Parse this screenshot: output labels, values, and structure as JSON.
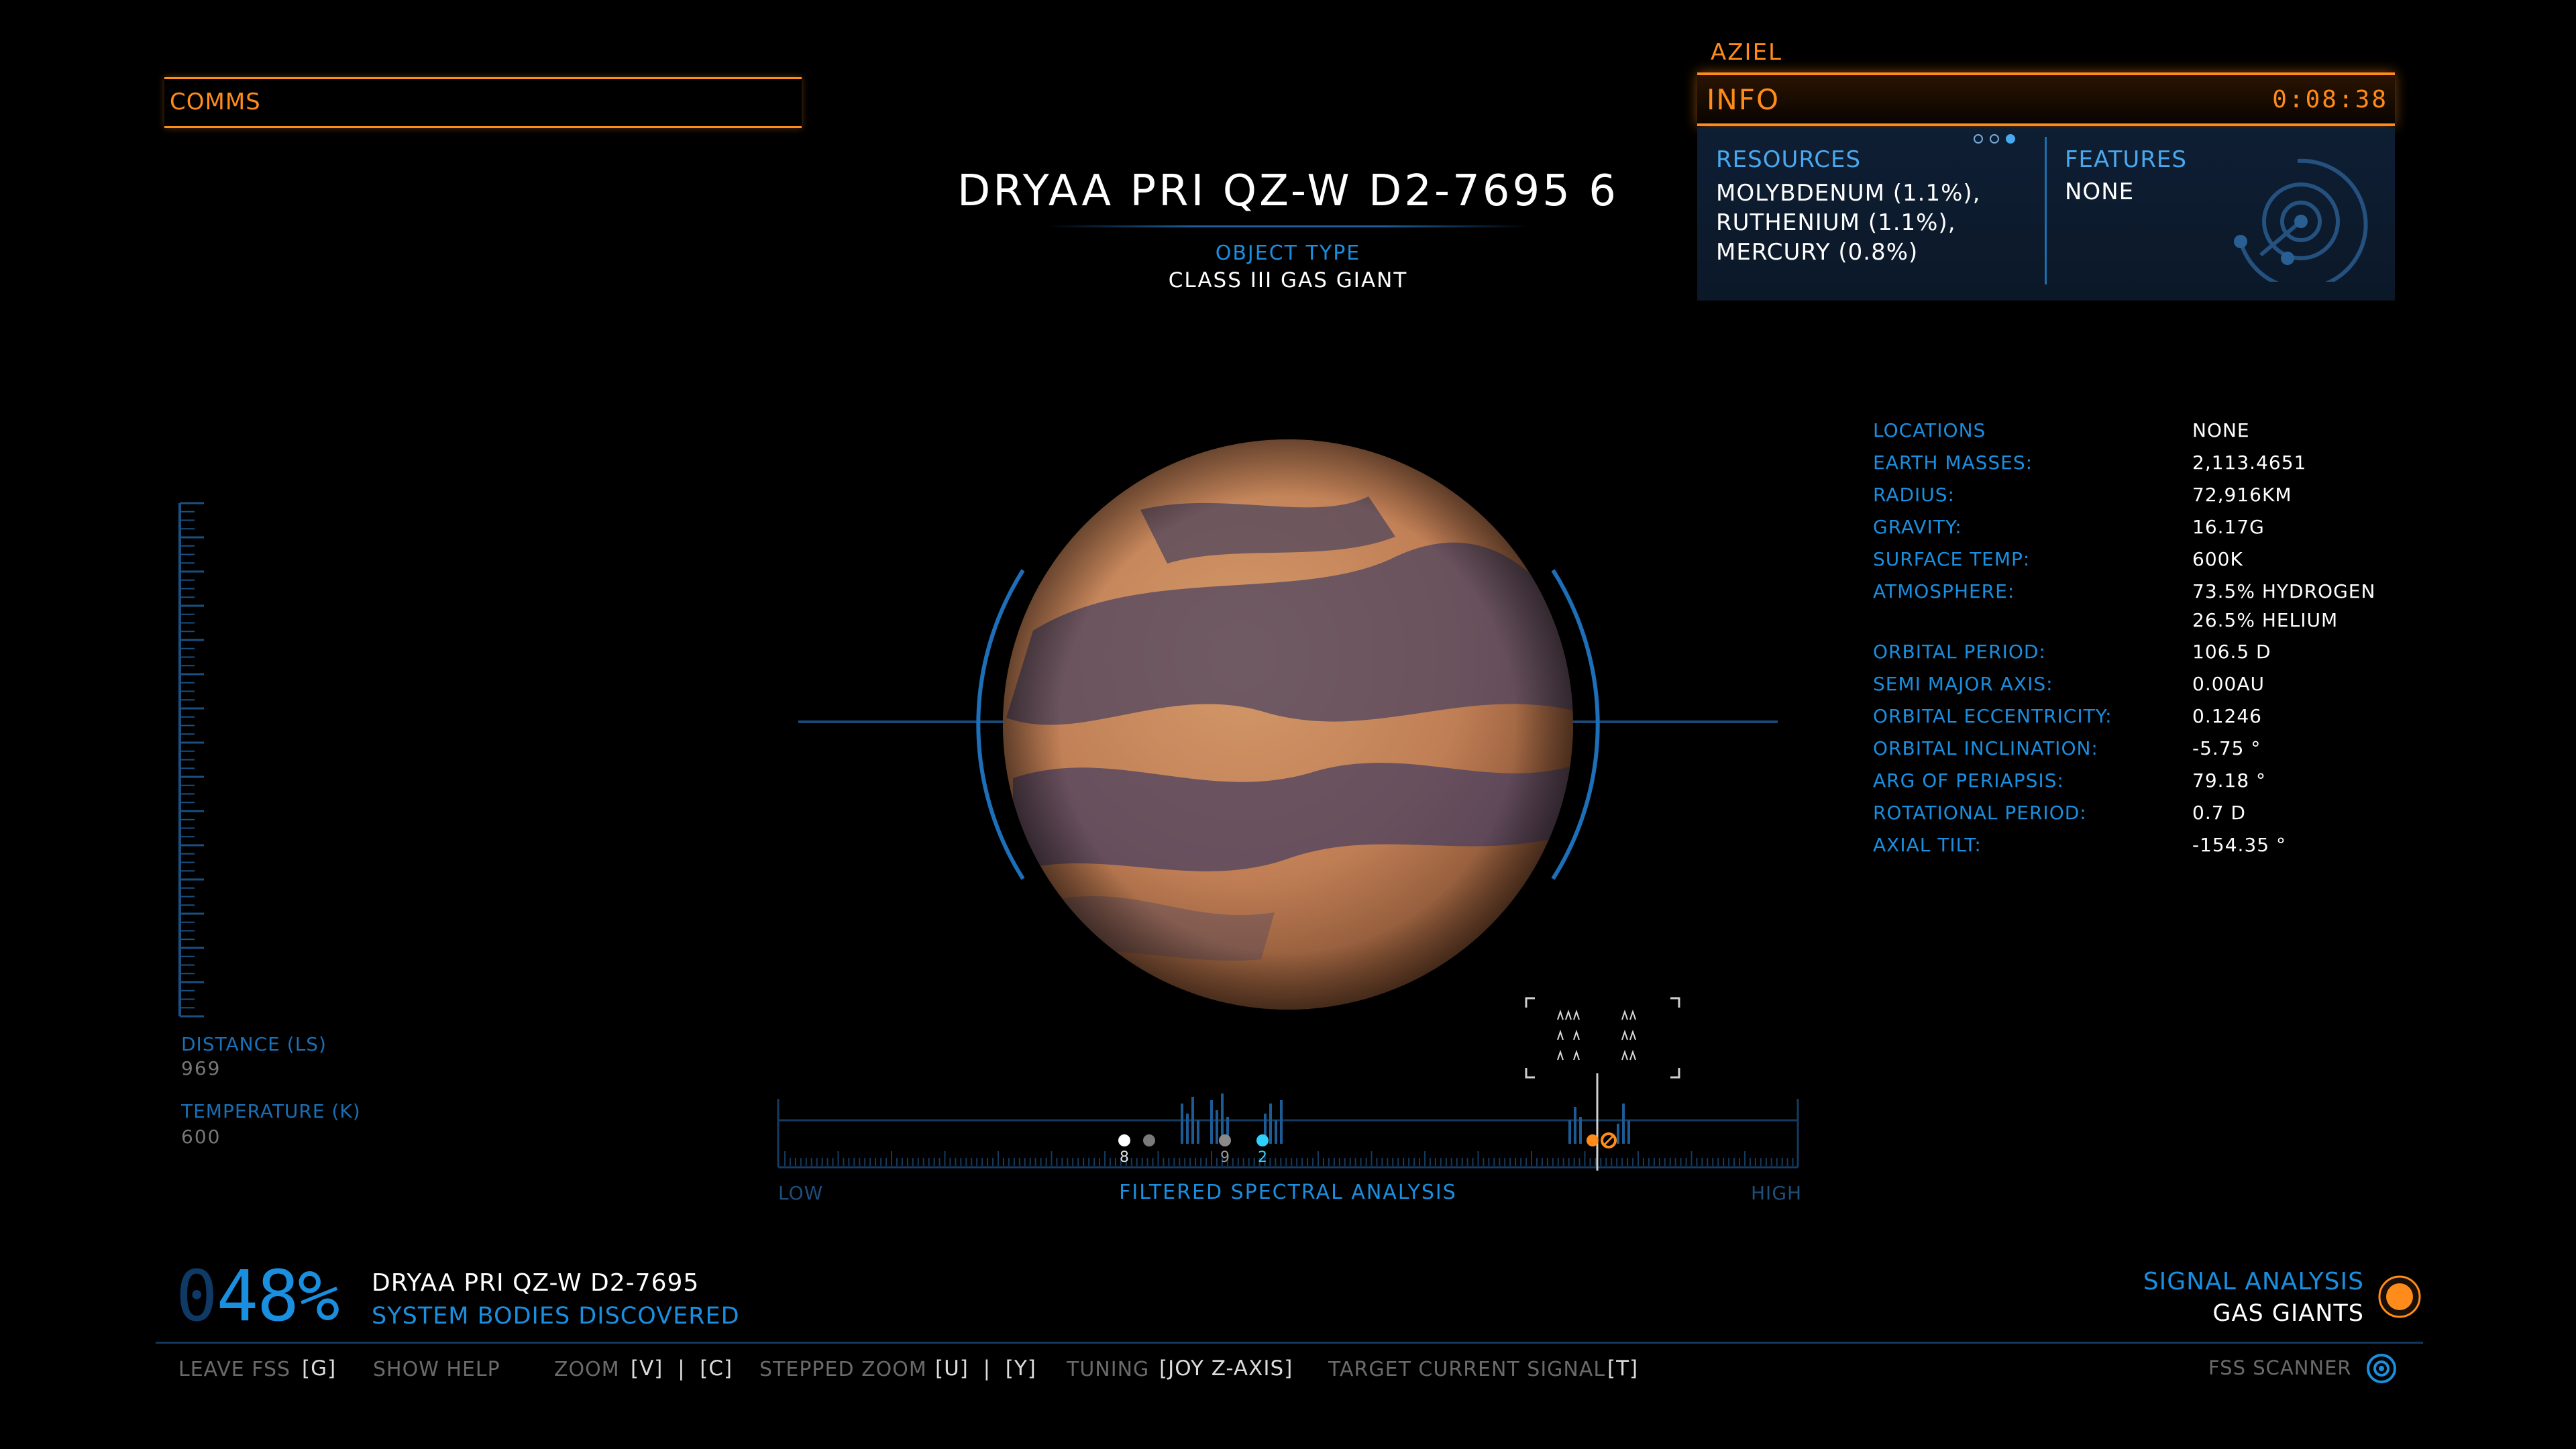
{
  "comms": {
    "label": "COMMS"
  },
  "info_panel": {
    "commander": "AZIEL",
    "title": "INFO",
    "timer": "0:08:38",
    "resources_label": "RESOURCES",
    "resources": [
      "MOLYBDENUM (1.1%),",
      "RUTHENIUM (1.1%),",
      "MERCURY (0.8%)"
    ],
    "features_label": "FEATURES",
    "features_value": "NONE"
  },
  "body": {
    "name": "DRYAA PRI QZ-W D2-7695 6",
    "object_type_label": "OBJECT TYPE",
    "object_type": "CLASS III GAS GIANT"
  },
  "stats": [
    {
      "label": "LOCATIONS",
      "value": "NONE"
    },
    {
      "label": "EARTH MASSES:",
      "value": "2,113.4651"
    },
    {
      "label": "RADIUS:",
      "value": "72,916KM"
    },
    {
      "label": "GRAVITY:",
      "value": "16.17G"
    },
    {
      "label": "SURFACE TEMP:",
      "value": "600K"
    },
    {
      "label": "ATMOSPHERE:",
      "value": "73.5% HYDROGEN"
    },
    {
      "label": "",
      "value": "26.5% HELIUM"
    },
    {
      "label": "ORBITAL PERIOD:",
      "value": "106.5 D"
    },
    {
      "label": "SEMI MAJOR AXIS:",
      "value": "0.00AU"
    },
    {
      "label": "ORBITAL ECCENTRICITY:",
      "value": "0.1246"
    },
    {
      "label": "ORBITAL INCLINATION:",
      "value": "-5.75 °"
    },
    {
      "label": "ARG OF PERIAPSIS:",
      "value": "79.18 °"
    },
    {
      "label": "ROTATIONAL PERIOD:",
      "value": "0.7 D"
    },
    {
      "label": "AXIAL TILT:",
      "value": "-154.35 °"
    }
  ],
  "gauge": {
    "distance_label": "DISTANCE (LS)",
    "distance_value": "969",
    "temperature_label": "TEMPERATURE (K)",
    "temperature_value": "600"
  },
  "spectrum": {
    "title": "FILTERED SPECTRAL ANALYSIS",
    "low_label": "LOW",
    "high_label": "HIGH",
    "markers": [
      {
        "label": "8"
      },
      {
        "label": ""
      },
      {
        "label": "9"
      },
      {
        "label": "2"
      },
      {
        "label": ""
      }
    ]
  },
  "discovery": {
    "percent_prefix": "0",
    "percent": "48%",
    "system_name": "DRYAA PRI QZ-W D2-7695",
    "caption": "SYSTEM BODIES DISCOVERED"
  },
  "signal": {
    "label": "SIGNAL ANALYSIS",
    "value": "GAS GIANTS"
  },
  "controls": [
    {
      "label": "LEAVE FSS",
      "key": "[G]"
    },
    {
      "label": "SHOW HELP",
      "key": ""
    },
    {
      "label": "ZOOM",
      "key": "[V]  |  [C]"
    },
    {
      "label": "STEPPED ZOOM",
      "key": "[U]  |  [Y]"
    },
    {
      "label": "TUNING",
      "key": "[JOY Z-AXIS]"
    },
    {
      "label": "TARGET CURRENT SIGNAL",
      "key": "[T]"
    }
  ],
  "fss": {
    "label": "FSS SCANNER"
  },
  "colors": {
    "orange": "#ff8c1a",
    "blue": "#1a8fe0",
    "planet": "#c98a5e"
  }
}
